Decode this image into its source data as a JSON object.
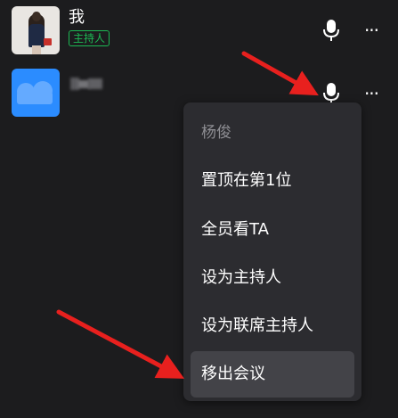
{
  "participants": [
    {
      "name": "我",
      "badge": "主持人",
      "avatar": "photo-avatar",
      "mic_icon": "microphone-icon",
      "more_icon": "more-icon",
      "more_glyph": "···"
    },
    {
      "name": "",
      "avatar": "blue-avatar",
      "mic_icon": "microphone-icon",
      "more_icon": "more-icon",
      "more_glyph": "···"
    }
  ],
  "context_menu": {
    "header": "杨俊",
    "items": [
      {
        "label": "置顶在第1位"
      },
      {
        "label": "全员看TA"
      },
      {
        "label": "设为主持人"
      },
      {
        "label": "设为联席主持人"
      },
      {
        "label": "移出会议",
        "highlighted": true
      }
    ]
  },
  "colors": {
    "background": "#1c1c1e",
    "menu_background": "#2c2c30",
    "highlight": "#434348",
    "host_badge": "#1db954",
    "annotation_arrow": "#e8201e",
    "avatar_blue": "#2b8cff"
  }
}
